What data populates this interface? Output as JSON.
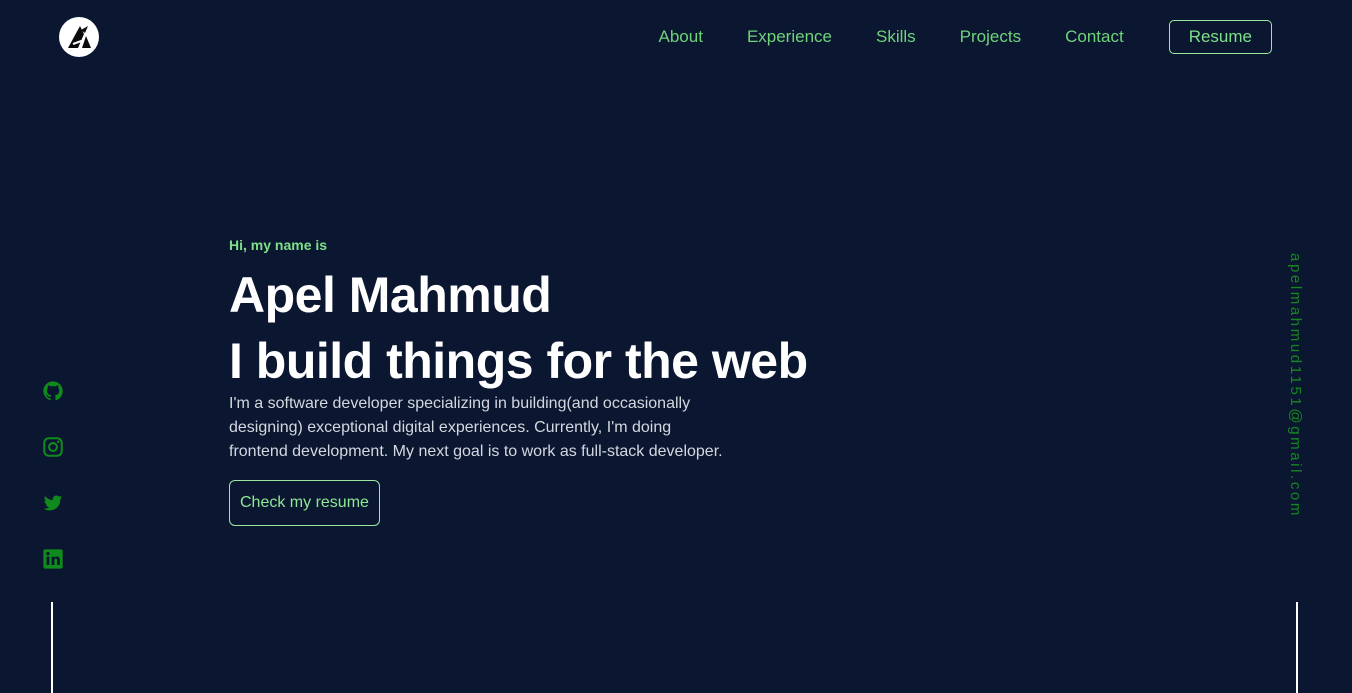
{
  "header": {
    "logo_alt": "A",
    "nav": {
      "about": "About",
      "experience": "Experience",
      "skills": "Skills",
      "projects": "Projects",
      "contact": "Contact"
    },
    "resume_label": "Resume"
  },
  "hero": {
    "greeting": "Hi, my name is",
    "name": "Apel Mahmud",
    "tagline": "I build things for the web",
    "bio": "I'm a software developer specializing in building(and occasionally designing) exceptional digital experiences. Currently, I'm doing frontend development. My next goal is to work as full-stack developer.",
    "cta_label": "Check my resume"
  },
  "socials": [
    {
      "icon": "github-icon"
    },
    {
      "icon": "instagram-icon"
    },
    {
      "icon": "twitter-icon"
    },
    {
      "icon": "linkedin-icon"
    }
  ],
  "email": "apelmahmud1151@gmail.com",
  "colors": {
    "background": "#0b1730",
    "accent": "#6fd37a",
    "social_green": "#0f8a1c",
    "text": "#ffffff"
  }
}
